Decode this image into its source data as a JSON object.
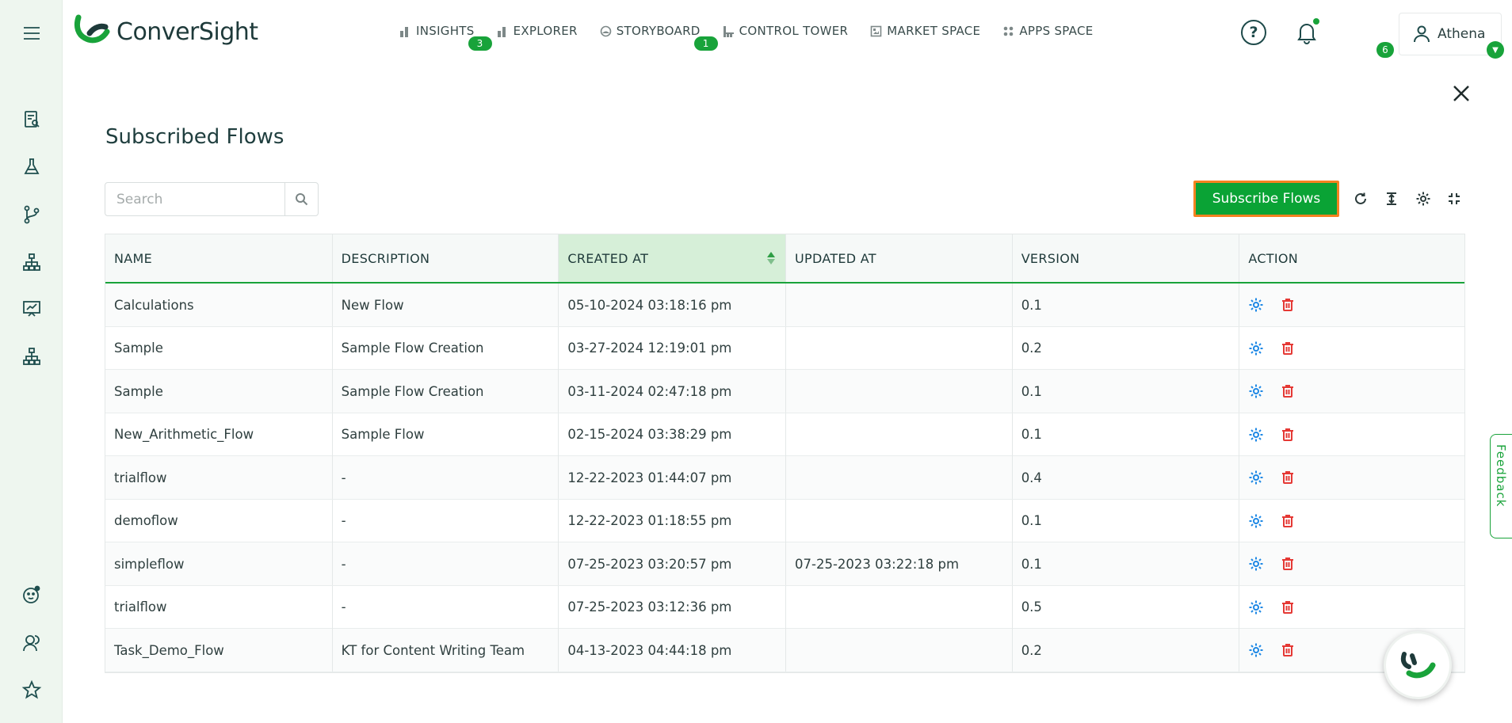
{
  "brand": {
    "name": "ConverSight"
  },
  "nav": [
    {
      "label": "INSIGHTS",
      "icon": "bar-chart-icon",
      "badge": "3"
    },
    {
      "label": "EXPLORER",
      "icon": "bar-chart-icon",
      "badge": ""
    },
    {
      "label": "STORYBOARD",
      "icon": "storyboard-icon",
      "badge": "1"
    },
    {
      "label": "CONTROL TOWER",
      "icon": "control-tower-icon",
      "badge": ""
    },
    {
      "label": "MARKET SPACE",
      "icon": "market-space-icon",
      "badge": ""
    },
    {
      "label": "APPS SPACE",
      "icon": "apps-grid-icon",
      "badge": ""
    }
  ],
  "header": {
    "help": "?",
    "notification_count": "6",
    "user_name": "Athena"
  },
  "page": {
    "title": "Subscribed Flows",
    "search_placeholder": "Search",
    "subscribe_label": "Subscribe Flows"
  },
  "table": {
    "columns": [
      "NAME",
      "DESCRIPTION",
      "CREATED AT",
      "UPDATED AT",
      "VERSION",
      "ACTION"
    ],
    "sorted_column": "CREATED AT",
    "rows": [
      {
        "name": "Calculations",
        "description": "New Flow",
        "created": "05-10-2024 03:18:16 pm",
        "updated": "",
        "version": "0.1"
      },
      {
        "name": "Sample",
        "description": "Sample Flow Creation",
        "created": "03-27-2024 12:19:01 pm",
        "updated": "",
        "version": "0.2"
      },
      {
        "name": "Sample",
        "description": "Sample Flow Creation",
        "created": "03-11-2024 02:47:18 pm",
        "updated": "",
        "version": "0.1"
      },
      {
        "name": "New_Arithmetic_Flow",
        "description": "Sample Flow",
        "created": "02-15-2024 03:38:29 pm",
        "updated": "",
        "version": "0.1"
      },
      {
        "name": "trialflow",
        "description": "-",
        "created": "12-22-2023 01:44:07 pm",
        "updated": "",
        "version": "0.4"
      },
      {
        "name": "demoflow",
        "description": "-",
        "created": "12-22-2023 01:18:55 pm",
        "updated": "",
        "version": "0.1"
      },
      {
        "name": "simpleflow",
        "description": "-",
        "created": "07-25-2023 03:20:57 pm",
        "updated": "07-25-2023 03:22:18 pm",
        "version": "0.1"
      },
      {
        "name": "trialflow",
        "description": "-",
        "created": "07-25-2023 03:12:36 pm",
        "updated": "",
        "version": "0.5"
      },
      {
        "name": "Task_Demo_Flow",
        "description": "KT for Content Writing Team",
        "created": "04-13-2023 04:44:18 pm",
        "updated": "",
        "version": "0.2"
      }
    ]
  },
  "feedback_label": "Feedback",
  "colors": {
    "accent": "#0aa335",
    "highlight_border": "#f58220",
    "sorted_header": "#d6efd8",
    "gear": "#1e88e5",
    "trash": "#e53935"
  }
}
